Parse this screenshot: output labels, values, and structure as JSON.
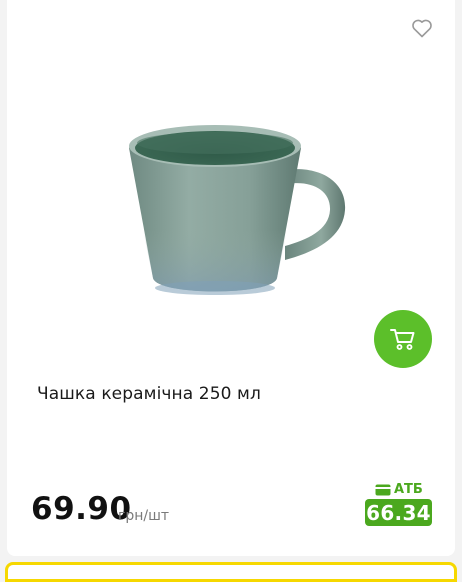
{
  "product": {
    "title": "Чашка керамічна 250 мл",
    "image": "ceramic-mug-green",
    "price": "69.90",
    "unit": "грн/шт",
    "promo": {
      "label": "АТБ",
      "price": "66.34"
    }
  },
  "icons": {
    "favorite": "heart-icon",
    "cart": "cart-icon",
    "card": "card-icon"
  },
  "colors": {
    "accent_green": "#5cbf2a",
    "promo_green": "#4ba81e",
    "next_card_border": "#f6d800"
  }
}
